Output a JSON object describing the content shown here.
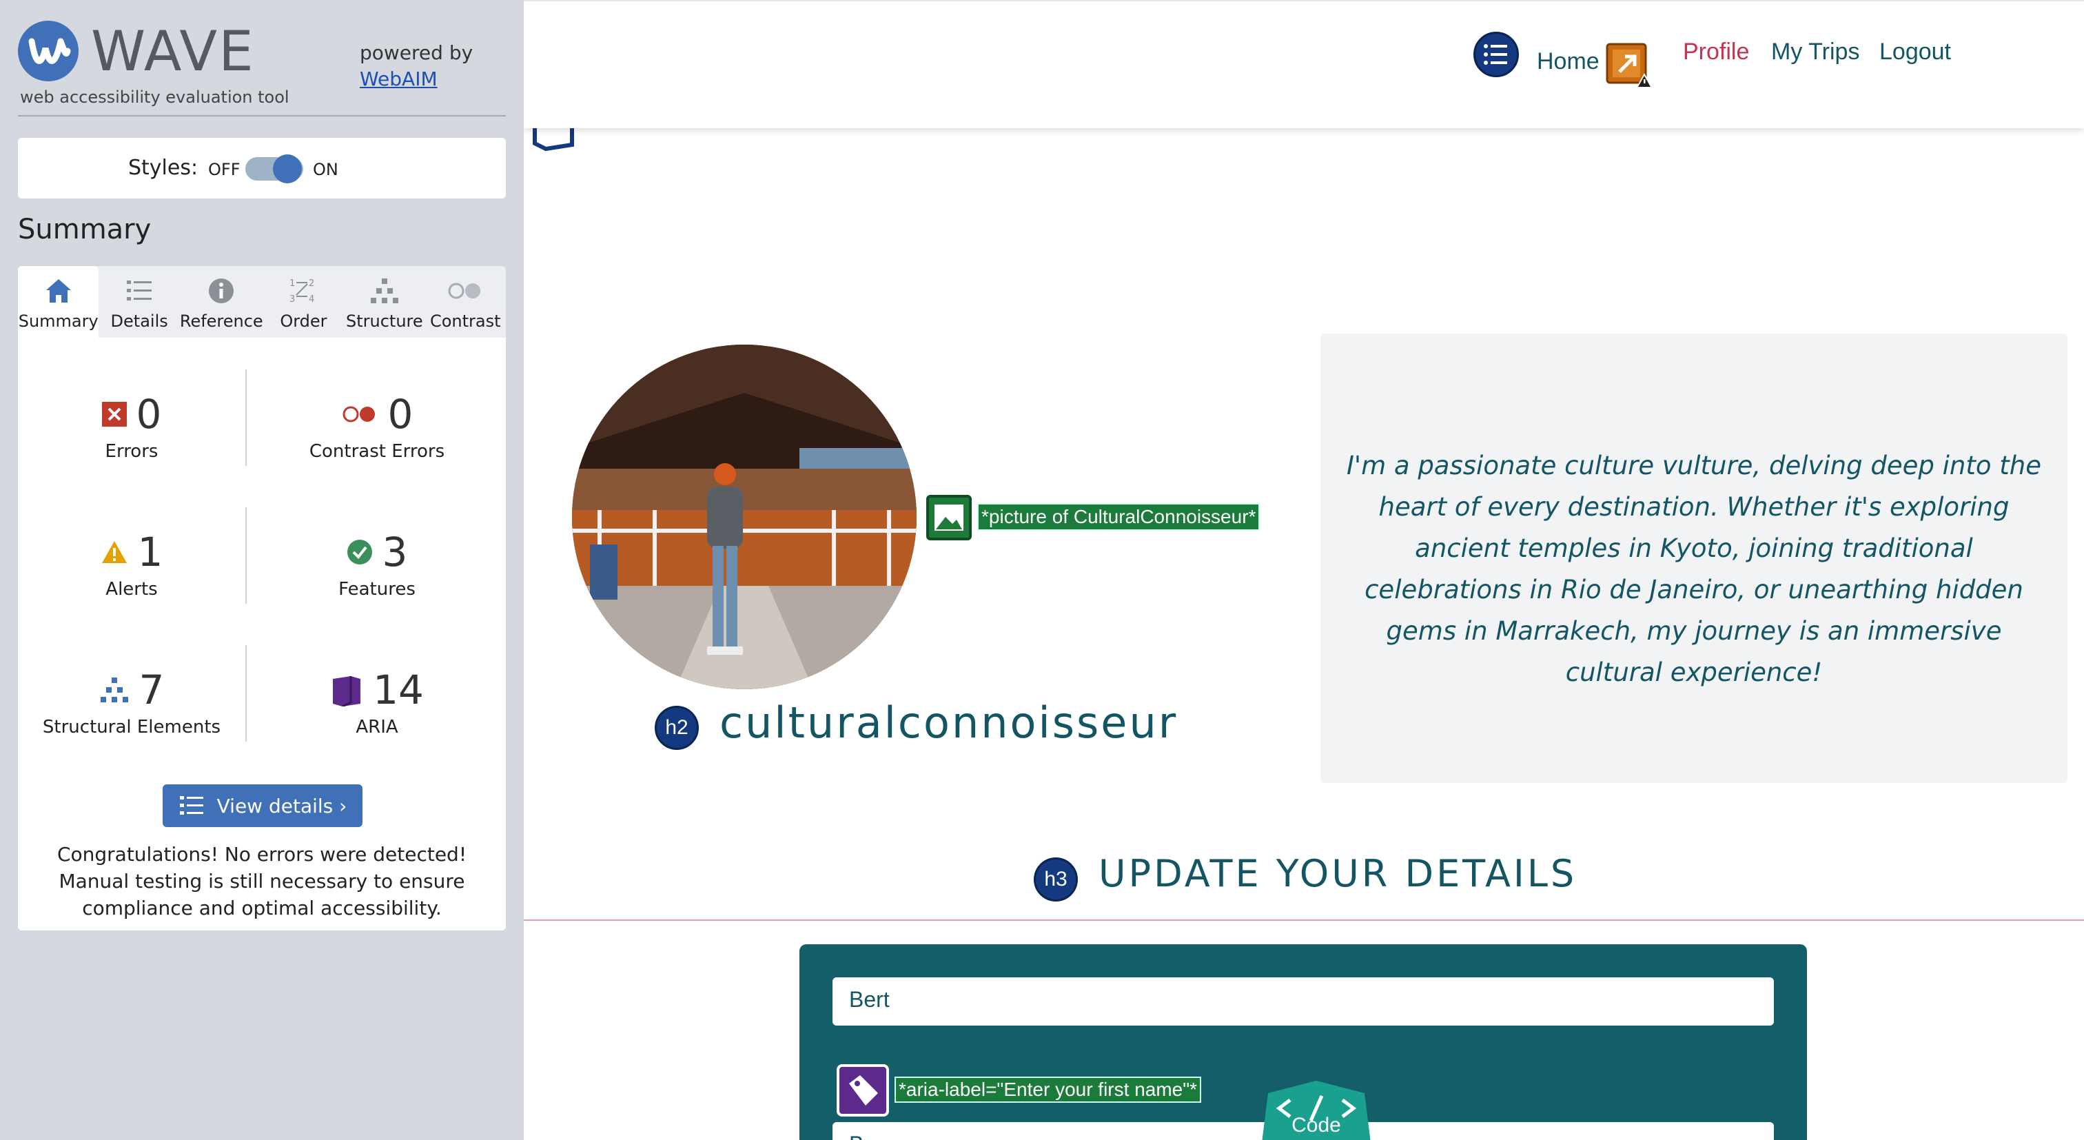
{
  "wave": {
    "title": "WAVE",
    "subtitle": "web accessibility evaluation tool",
    "powered_by": "powered by",
    "webaim_link": "WebAIM",
    "styles_label": "Styles:",
    "styles_off": "OFF",
    "styles_on": "ON",
    "styles_enabled": true,
    "summary_heading": "Summary",
    "tabs": [
      {
        "label": "Summary",
        "icon": "home-icon",
        "active": true
      },
      {
        "label": "Details",
        "icon": "list-icon",
        "active": false
      },
      {
        "label": "Reference",
        "icon": "info-icon",
        "active": false
      },
      {
        "label": "Order",
        "icon": "order-icon",
        "active": false
      },
      {
        "label": "Structure",
        "icon": "structure-icon",
        "active": false
      },
      {
        "label": "Contrast",
        "icon": "contrast-icon",
        "active": false
      }
    ],
    "stats": {
      "errors": {
        "count": "0",
        "label": "Errors",
        "color": "#c0392b"
      },
      "contrast_errors": {
        "count": "0",
        "label": "Contrast Errors",
        "color": "#c0392b"
      },
      "alerts": {
        "count": "1",
        "label": "Alerts",
        "color": "#e5a100"
      },
      "features": {
        "count": "3",
        "label": "Features",
        "color": "#3a8f5a"
      },
      "structural": {
        "count": "7",
        "label": "Structural Elements",
        "color": "#3f70b8"
      },
      "aria": {
        "count": "14",
        "label": "ARIA",
        "color": "#5b2a8a"
      }
    },
    "view_details": "View details ›",
    "congrats": "Congratulations! No errors were detected! Manual testing is still necessary to ensure compliance and optimal accessibility.",
    "accent": "#3f70b8"
  },
  "site": {
    "nav": {
      "home": "Home",
      "profile": "Profile",
      "my_trips": "My Trips",
      "logout": "Logout"
    },
    "profile": {
      "alt_label": "*picture of CulturalConnoisseur*",
      "h2_tag": "h2",
      "username": "culturalconnoisseur",
      "bio": "I'm a passionate culture vulture, delving deep into the heart of every destination. Whether it's exploring ancient temples in Kyoto, joining traditional celebrations in Rio de Janeiro, or unearthing hidden gems in Marrakech, my journey is an immersive cultural experience!"
    },
    "update": {
      "h3_tag": "h3",
      "heading": "UPDATE YOUR DETAILS",
      "first_name_value": "Bert",
      "aria_label": "*aria-label=\"Enter your first name\"*",
      "last_name_value": "B",
      "code_button": "Code"
    },
    "colors": {
      "teal": "#145564",
      "pink": "#c8324f",
      "panel": "#145e6a"
    }
  }
}
